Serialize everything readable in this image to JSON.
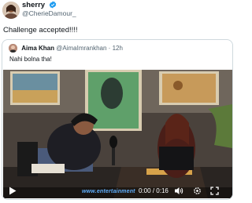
{
  "tweet": {
    "display_name": "sherry",
    "handle": "@CherieDamour_",
    "text": "Challenge accepted!!!!",
    "verified_icon": "verified-badge-icon"
  },
  "quoted_tweet": {
    "display_name": "Aima Khan",
    "handle": "@AimaImrankhan",
    "separator": "·",
    "time": "12h",
    "text": "Nahi bolna tha!"
  },
  "video": {
    "current_time": "0:00",
    "separator": "/",
    "duration": "0:16",
    "progress": 0,
    "ticker_text": "www.entertainment",
    "icons": [
      "play-icon",
      "volume-icon",
      "settings-icon",
      "fullscreen-icon"
    ]
  },
  "colors": {
    "verified_blue": "#1d9bf0",
    "text_primary": "#0f1419",
    "text_secondary": "#536471",
    "border": "#cfd9de"
  }
}
